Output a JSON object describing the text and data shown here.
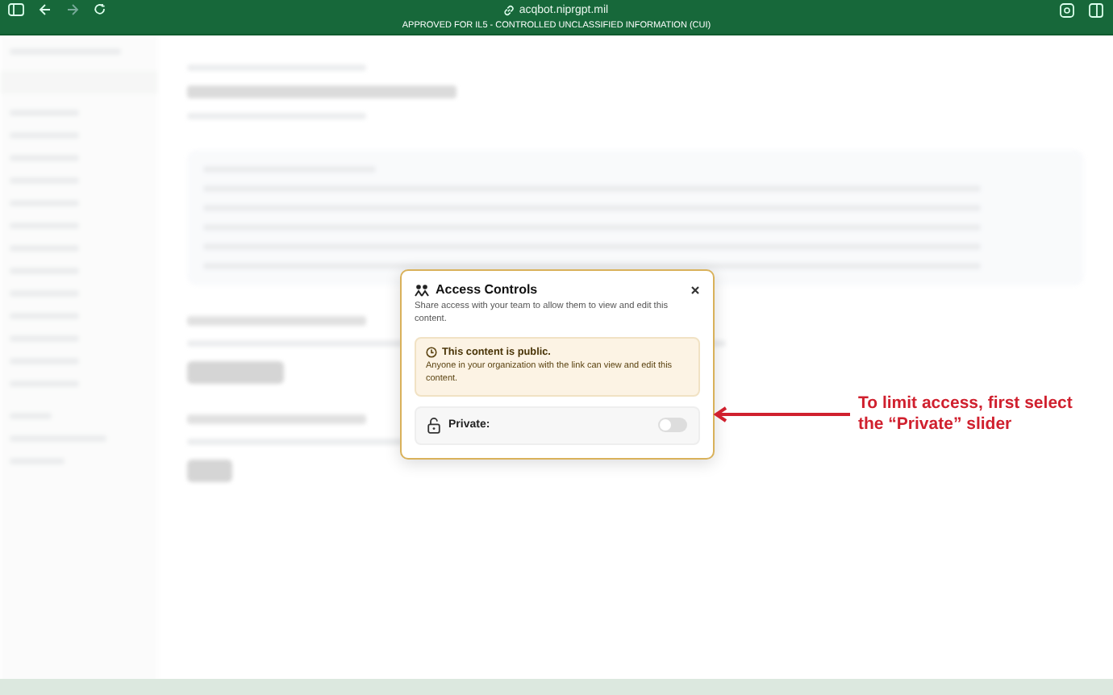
{
  "browser": {
    "url": "acqbot.niprgpt.mil"
  },
  "banner": {
    "text": "APPROVED FOR IL5 - CONTROLLED UNCLASSIFIED INFORMATION (CUI)"
  },
  "modal": {
    "title": "Access Controls",
    "description": "Share access with your team to allow them to view and edit this content.",
    "notice": {
      "title": "This content is public.",
      "body": "Anyone in your organization with the link can view and edit this content."
    },
    "private": {
      "label": "Private:",
      "on": false
    }
  },
  "annotation": {
    "text": "To limit access, first select the “Private” slider"
  }
}
